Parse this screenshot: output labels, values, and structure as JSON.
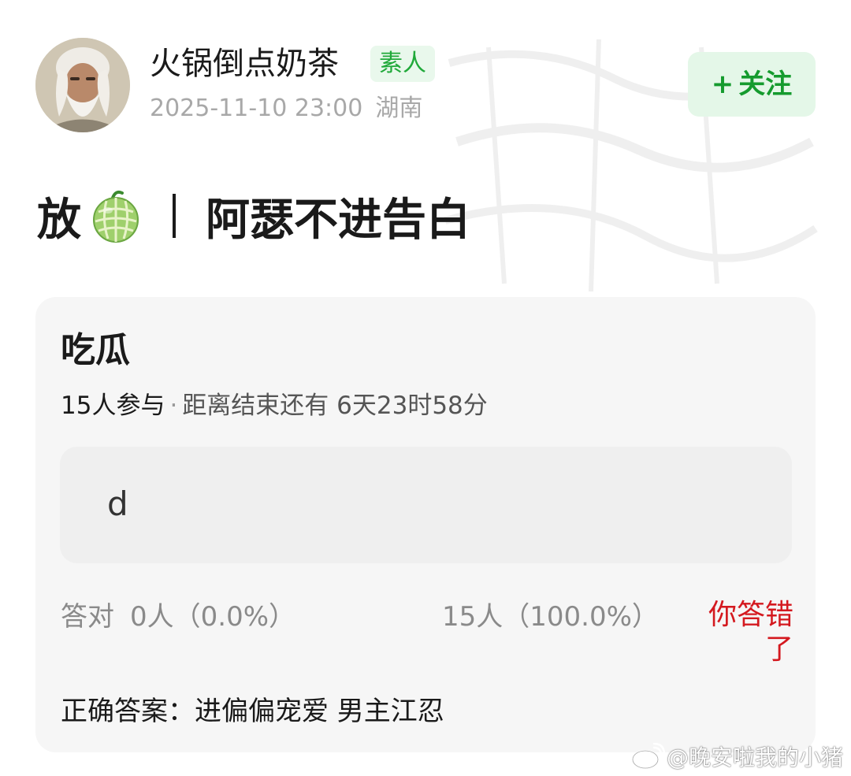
{
  "author": {
    "name": "火锅倒点奶茶",
    "badge": "素人",
    "timestamp": "2025-11-10 23:00",
    "location": "湖南",
    "avatar_icon": "old-man-avatar"
  },
  "follow_button": {
    "plus": "+",
    "label": "关注"
  },
  "post": {
    "title_prefix": "放",
    "title_icon": "melon-emoji",
    "title_text": "阿瑟不进告白"
  },
  "quiz": {
    "title": "吃瓜",
    "participants": "15人参与",
    "separator": "·",
    "remaining": "距离结束还有 6天23时58分",
    "option": "d",
    "correct_label": "答对",
    "correct_count": "0人（0.0%）",
    "wrong_count": "15人（100.0%）",
    "wrong_message": "你答错了",
    "answer": "正确答案：进偏偏宠爱 男主江忍"
  },
  "watermark": {
    "icon": "weibo-icon",
    "text": "@晚安啦我的小猪"
  },
  "colors": {
    "badge_bg": "#e9f8ec",
    "badge_text": "#20a93a",
    "follow_bg": "#e4f7e8",
    "follow_text": "#159b2e",
    "wrong_text": "#d4191f",
    "card_bg": "#f6f6f6",
    "option_bg": "#efefef"
  }
}
